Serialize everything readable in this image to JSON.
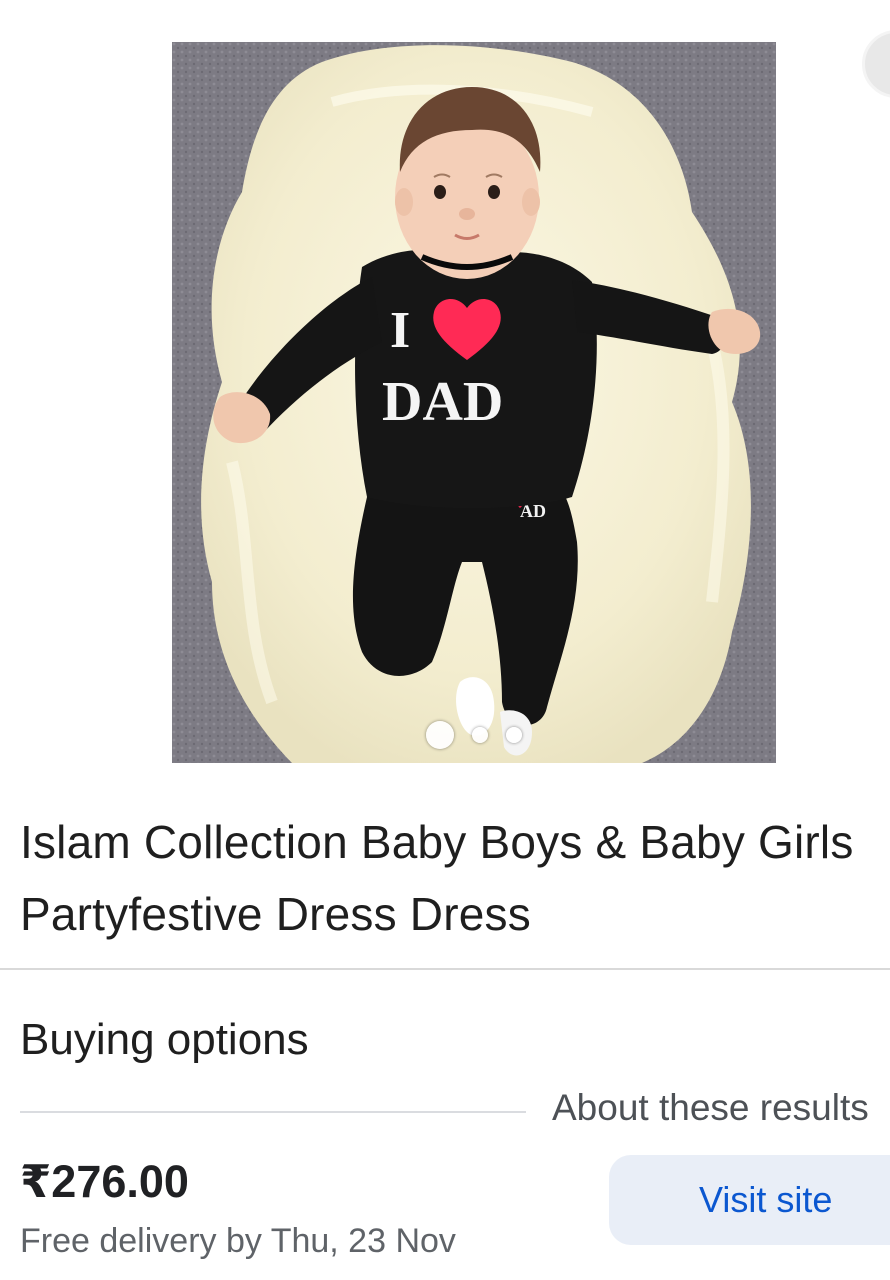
{
  "product": {
    "title": "Islam Collection Baby Boys & Baby Girls Partyfestive Dress Dress",
    "image": {
      "print_line1": "I",
      "print_line2": "DAD",
      "pants_print": "AD",
      "carousel": {
        "total_images": 3,
        "active_index": 0
      },
      "colors": {
        "background": "#7d7b84",
        "rug": "#f6f0d2",
        "outfit": "#151515",
        "heart": "#ff2a55"
      }
    }
  },
  "buying_options": {
    "heading": "Buying options",
    "about_label": "About these results",
    "offer": {
      "price": "₹276.00",
      "delivery": "Free delivery by Thu, 23 Nov",
      "button_label": "Visit site"
    }
  },
  "colors": {
    "link_blue": "#0b57d0",
    "button_bg": "#e9eef7",
    "divider": "#d9d9d9",
    "secondary_text": "#5f6368"
  }
}
